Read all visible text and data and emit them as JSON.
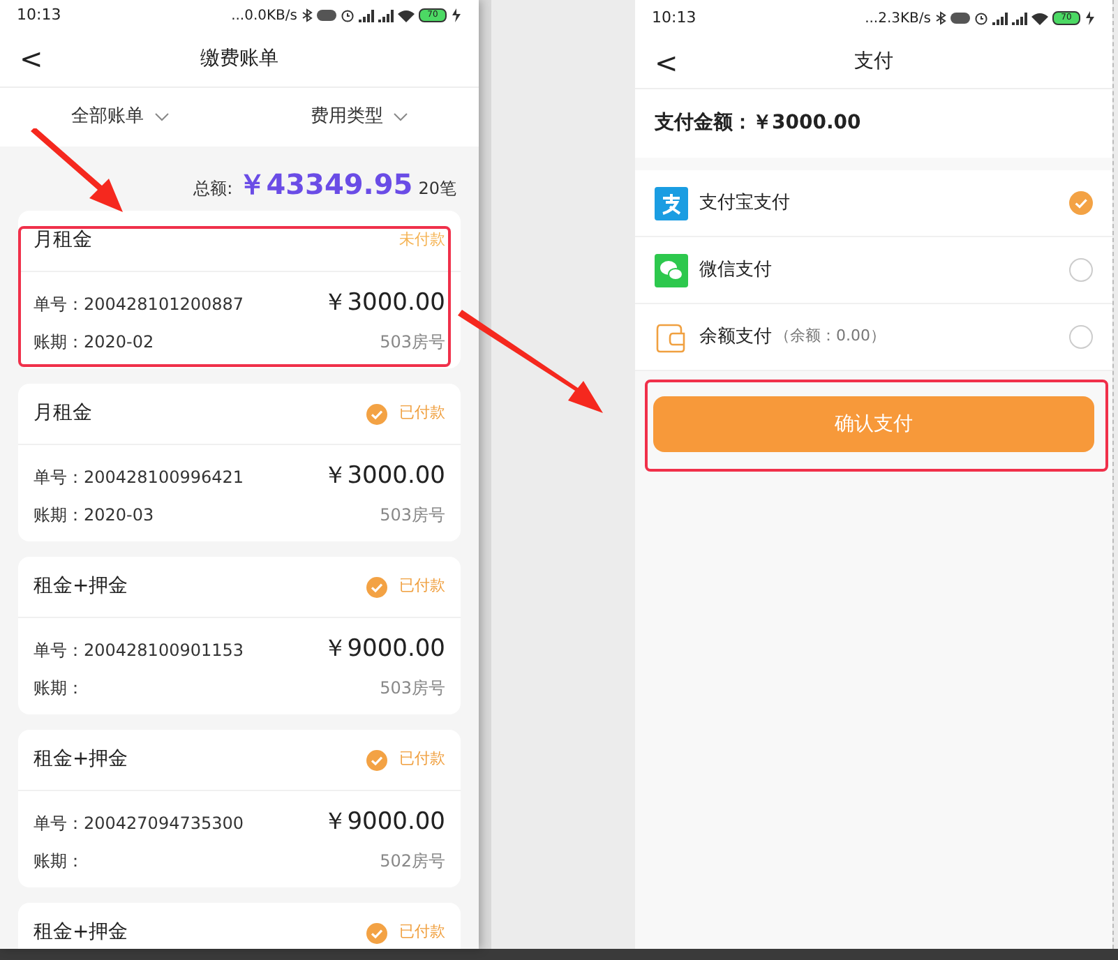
{
  "left_screen": {
    "status_bar": {
      "time": "10:13",
      "speed": "...0.0KB/s",
      "battery": "70"
    },
    "nav": {
      "back": "<",
      "title": "缴费账单"
    },
    "filters": [
      {
        "label": "全部账单"
      },
      {
        "label": "费用类型"
      }
    ],
    "summary": {
      "label": "总额:",
      "amount": "￥43349.95",
      "count": "20笔"
    },
    "bills": [
      {
        "title": "月租金",
        "paid": false,
        "status": "未付款",
        "number": "单号：200428101200887",
        "amount": "￥3000.00",
        "period": "账期：2020-02",
        "room": "503房号"
      },
      {
        "title": "月租金",
        "paid": true,
        "status": "已付款",
        "number": "单号：200428100996421",
        "amount": "￥3000.00",
        "period": "账期：2020-03",
        "room": "503房号"
      },
      {
        "title": "租金+押金",
        "paid": true,
        "status": "已付款",
        "number": "单号：200428100901153",
        "amount": "￥9000.00",
        "period": "账期：",
        "room": "503房号"
      },
      {
        "title": "租金+押金",
        "paid": true,
        "status": "已付款",
        "number": "单号：200427094735300",
        "amount": "￥9000.00",
        "period": "账期：",
        "room": "502房号"
      },
      {
        "title": "租金+押金",
        "paid": true,
        "status": "已付款"
      }
    ]
  },
  "right_screen": {
    "status_bar": {
      "time": "10:13",
      "speed": "...2.3KB/s",
      "battery": "70"
    },
    "nav": {
      "back": "<",
      "title": "支付"
    },
    "amount": "支付金额：￥3000.00",
    "methods": [
      {
        "kind": "alipay",
        "label": "支付宝支付",
        "selected": true
      },
      {
        "kind": "wechat",
        "label": "微信支付",
        "selected": false
      },
      {
        "kind": "wallet",
        "label": "余额支付",
        "note": "（余额：0.00）",
        "selected": false
      }
    ],
    "confirm_button": "确认支付"
  }
}
